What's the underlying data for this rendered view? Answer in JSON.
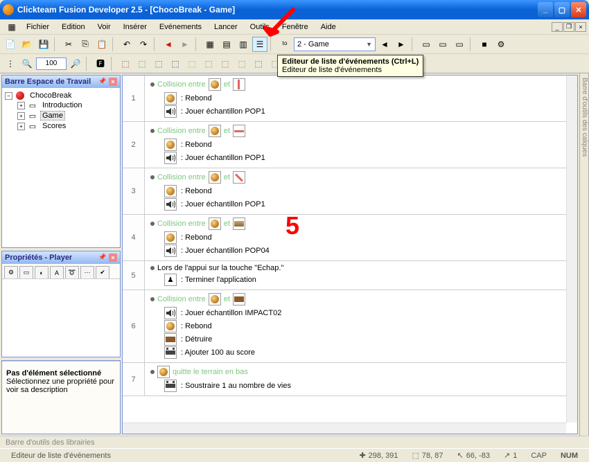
{
  "window": {
    "title": "Clickteam Fusion Developer 2.5 - [ChocoBreak - Game]"
  },
  "menu": {
    "items": [
      "Fichier",
      "Edition",
      "Voir",
      "Insérer",
      "Evénements",
      "Lancer",
      "Outils",
      "Fenêtre",
      "Aide"
    ]
  },
  "toolbar": {
    "zoom": "100",
    "frame_combo": "2 - Game"
  },
  "tooltip": {
    "title": "Editeur de liste d'événements (Ctrl+L)",
    "sub": "Editeur de liste d'événements"
  },
  "annotations": {
    "big_number": "5"
  },
  "workspace": {
    "header": "Barre Espace de Travail",
    "root": "ChocoBreak",
    "items": [
      "Introduction",
      "Game",
      "Scores"
    ],
    "selected": "Game"
  },
  "properties": {
    "header": "Propriétés - Player",
    "footer_title": "Pas d'élément sélectionné",
    "footer_sub": "Sélectionnez une propriété pour voir sa description"
  },
  "right_panel": "Barre d'outils des calques",
  "lib_bar": "Barre d'outils des librairies",
  "statusbar": {
    "text": "Editeur de liste d'événements",
    "coord1": "298, 391",
    "coord2": "78, 87",
    "coord3": "66, -83",
    "coord4": "1",
    "caps": "CAP",
    "num": "NUM"
  },
  "labels": {
    "collision": "Collision entre",
    "et": "et",
    "rebond": ": Rebond",
    "pop1": ": Jouer échantillon POP1",
    "pop04": ": Jouer échantillon POP04",
    "escape_cond": "Lors de l'appui sur la touche \"Echap.\"",
    "terminate": ": Terminer l'application",
    "impact": ": Jouer échantillon IMPACT02",
    "destroy": ": Détruire",
    "add_score": ": Ajouter 100 au score",
    "leave_bottom": "quitte le terrain en bas",
    "sub_life": ": Soustraire 1 au nombre de vies"
  },
  "events": [
    {
      "num": "1",
      "type": "collision",
      "obj2": "wall-v",
      "actions": [
        "rebond",
        "pop1"
      ]
    },
    {
      "num": "2",
      "type": "collision",
      "obj2": "wall-h",
      "actions": [
        "rebond",
        "pop1"
      ]
    },
    {
      "num": "3",
      "type": "collision",
      "obj2": "wall-d",
      "actions": [
        "rebond",
        "pop1"
      ]
    },
    {
      "num": "4",
      "type": "collision",
      "obj2": "paddle",
      "actions": [
        "rebond",
        "pop04"
      ]
    },
    {
      "num": "5",
      "type": "escape",
      "actions": [
        "terminate"
      ]
    },
    {
      "num": "6",
      "type": "collision",
      "obj2": "brick",
      "actions": [
        "impact",
        "rebond",
        "destroy",
        "add_score"
      ]
    },
    {
      "num": "7",
      "type": "leave",
      "actions": [
        "sub_life"
      ]
    }
  ]
}
